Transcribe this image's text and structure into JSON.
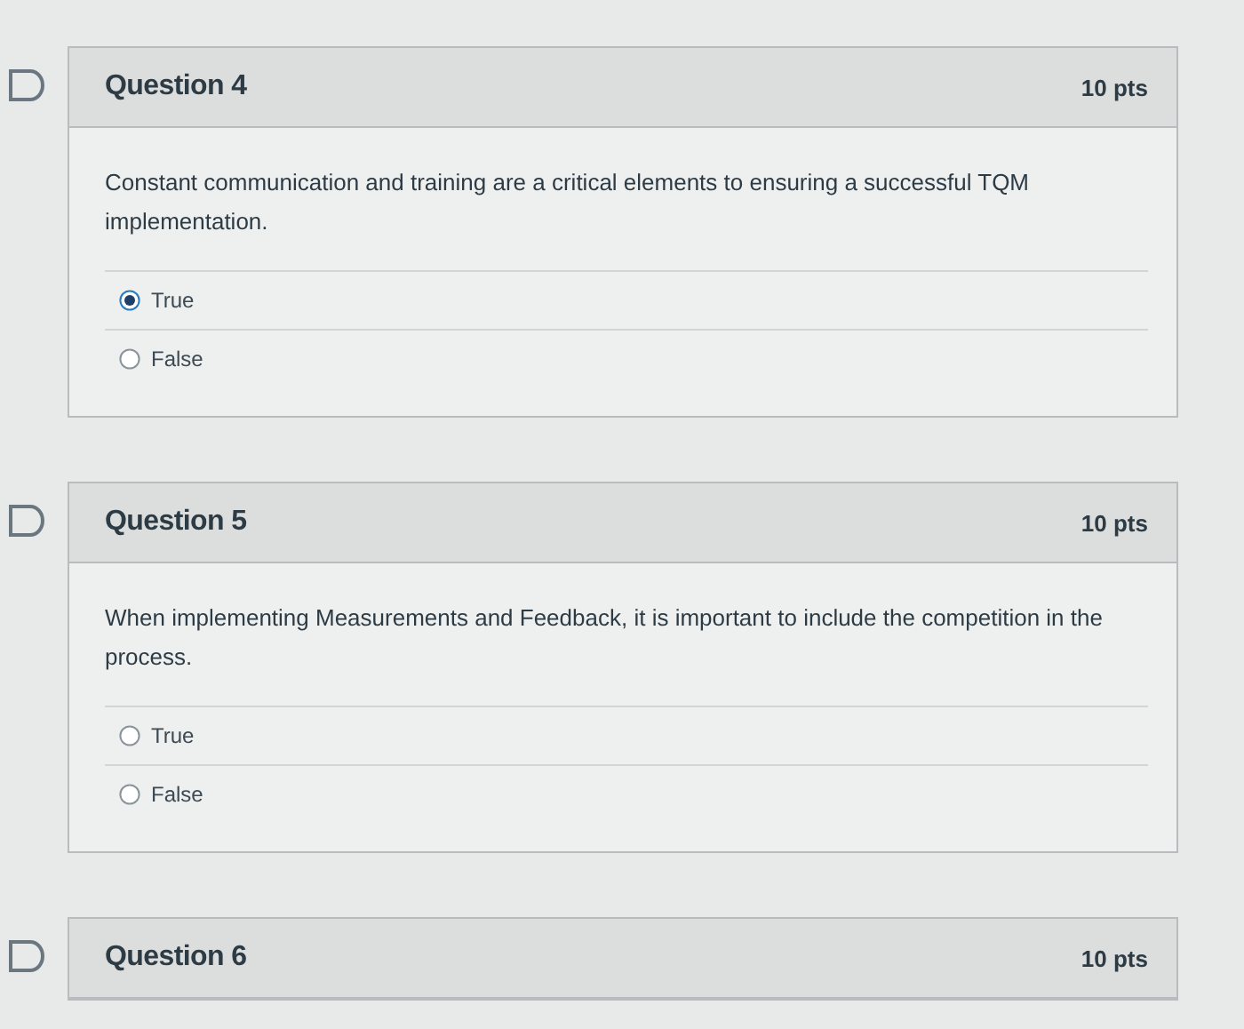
{
  "questions": [
    {
      "title": "Question 4",
      "points": "10 pts",
      "text": "Constant communication and training are a critical elements to ensuring a successful TQM implementation.",
      "answers": [
        {
          "label": "True",
          "selected": true
        },
        {
          "label": "False",
          "selected": false
        }
      ]
    },
    {
      "title": "Question 5",
      "points": "10 pts",
      "text": "When implementing Measurements and Feedback, it is important to include the competition in the process.",
      "answers": [
        {
          "label": "True",
          "selected": false
        },
        {
          "label": "False",
          "selected": false
        }
      ]
    },
    {
      "title": "Question 6",
      "points": "10 pts"
    }
  ]
}
